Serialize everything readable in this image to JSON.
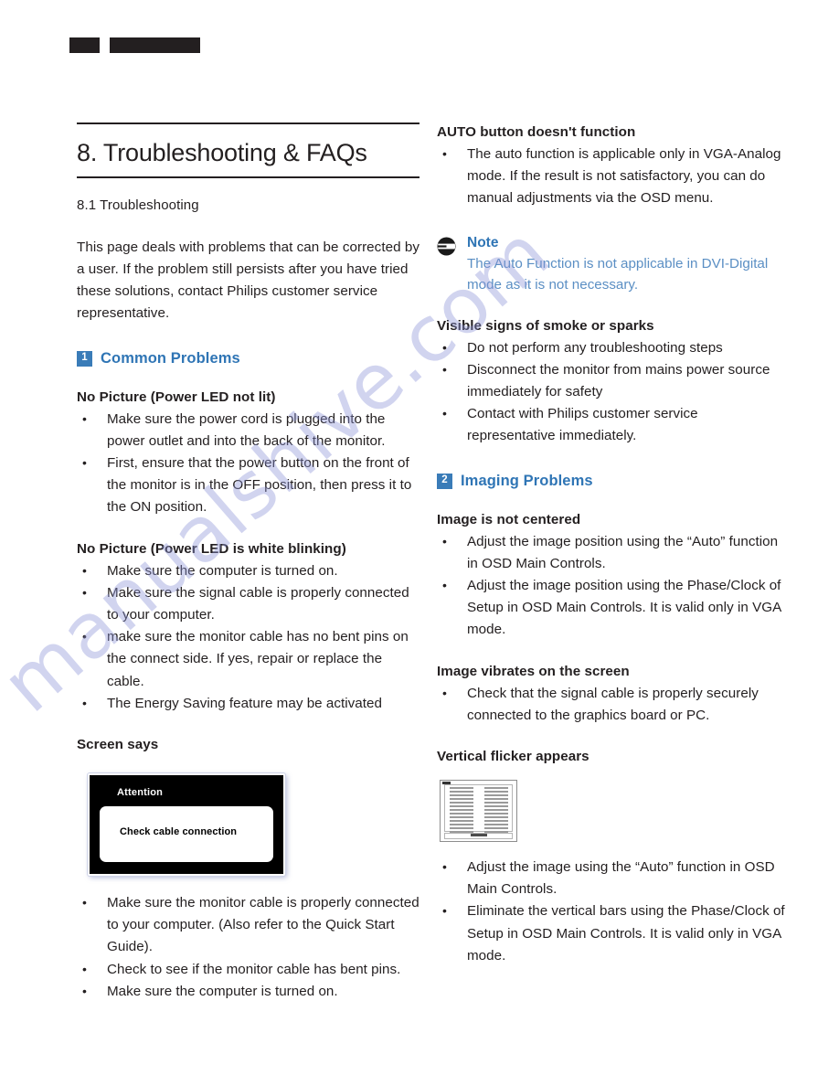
{
  "page": {
    "redaction_bars": [
      "",
      ""
    ],
    "watermark": "manualshive.com",
    "accent_blue": "#2f75b5",
    "badge_blue": "#3a7cb8",
    "note_text_blue": "#5b8fc4"
  },
  "chapter": {
    "title": "8. Troubleshooting & FAQs",
    "section_number_title": "8.1 Troubleshooting",
    "intro": "This page deals with problems that can be corrected by a user. If the problem still persists after you have tried these solutions, contact Philips customer service representative."
  },
  "left_column": {
    "common_problems": {
      "badge": "1",
      "label": "Common Problems"
    },
    "sections": [
      {
        "heading": "No Picture (Power LED not lit)",
        "bullets": [
          "Make sure the power cord is plugged into the power outlet and into the back of the monitor.",
          "First, ensure that the power button on the front of the monitor is in the OFF position, then press it to the ON position."
        ]
      },
      {
        "heading": "No Picture (Power LED is white blinking)",
        "bullets": [
          "Make sure the computer is turned on.",
          "Make sure the signal cable is properly connected to your computer.",
          "make sure the monitor cable has no bent pins on the connect side. If yes, repair or replace the cable.",
          "The Energy Saving feature may be activated"
        ]
      }
    ],
    "screen_says": {
      "heading": "Screen says",
      "osd": {
        "title": "Attention",
        "message": "Check cable connection"
      },
      "bullets": [
        "Make sure the monitor cable is properly connected to your computer. (Also refer to the Quick Start Guide).",
        "Check to see if the monitor cable has bent pins.",
        "Make sure the computer is turned on."
      ]
    }
  },
  "right_column": {
    "auto_button": {
      "heading": "AUTO button doesn't function",
      "bullets": [
        "The auto function is applicable only in VGA-Analog mode.  If the result is not satisfactory, you can do manual adjustments via the OSD menu."
      ]
    },
    "note": {
      "icon": "note-icon",
      "title": "Note",
      "body": "The Auto Function is not applicable in DVI-Digital mode as it is not necessary."
    },
    "smoke": {
      "heading": "Visible signs of smoke or sparks",
      "bullets": [
        "Do not perform any troubleshooting steps",
        "Disconnect the monitor from mains power source immediately for safety",
        "Contact with Philips customer service representative immediately."
      ]
    },
    "imaging_problems": {
      "badge": "2",
      "label": "Imaging Problems"
    },
    "sections": [
      {
        "heading": "Image is not centered",
        "bullets": [
          "Adjust the image position using the “Auto” function in OSD Main Controls.",
          "Adjust the image position using the Phase/Clock of Setup in OSD Main Controls.  It is valid only in VGA mode."
        ]
      },
      {
        "heading": "Image vibrates on the screen",
        "bullets": [
          "Check that the signal cable is properly securely connected to the graphics board or PC."
        ]
      }
    ],
    "vertical_flicker": {
      "heading": "Vertical flicker appears",
      "bullets": [
        "Adjust the image using the “Auto” function in OSD Main Controls.",
        "Eliminate the vertical bars using the Phase/Clock of Setup in OSD Main Controls. It is valid only in VGA mode."
      ]
    }
  }
}
